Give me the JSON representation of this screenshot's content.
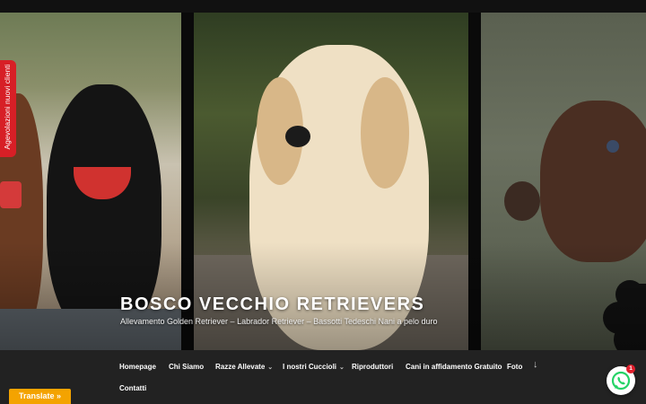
{
  "side_tab": {
    "label": "Agevolazioni nuovi clienti"
  },
  "site": {
    "title": "BOSCO VECCHIO RETRIEVERS",
    "description": "Allevamento Golden Retriever – Labrador Retriever – Bassotti Tedeschi Nani a pelo duro"
  },
  "nav": {
    "items": [
      {
        "label": "Homepage",
        "dropdown": false
      },
      {
        "label": "Chi Siamo",
        "dropdown": false
      },
      {
        "label": "Razze Allevate",
        "dropdown": true
      },
      {
        "label": "I nostri Cuccioli",
        "dropdown": true
      },
      {
        "label": "Riproduttori",
        "dropdown": false
      },
      {
        "label": "Cani in affidamento Gratuito",
        "dropdown": false
      },
      {
        "label": "Foto",
        "dropdown": false
      },
      {
        "label": "Contatti",
        "dropdown": false
      }
    ],
    "chevron": "⌄",
    "scroll_icon": "↓"
  },
  "translate": {
    "label": "Translate »"
  },
  "whatsapp": {
    "badge_count": "1",
    "icon": "whatsapp-icon"
  },
  "colors": {
    "nav_bg": "#222222",
    "side_tab": "#d71f26",
    "translate": "#f4a300",
    "badge": "#e01e2b",
    "whatsapp": "#25d366"
  }
}
